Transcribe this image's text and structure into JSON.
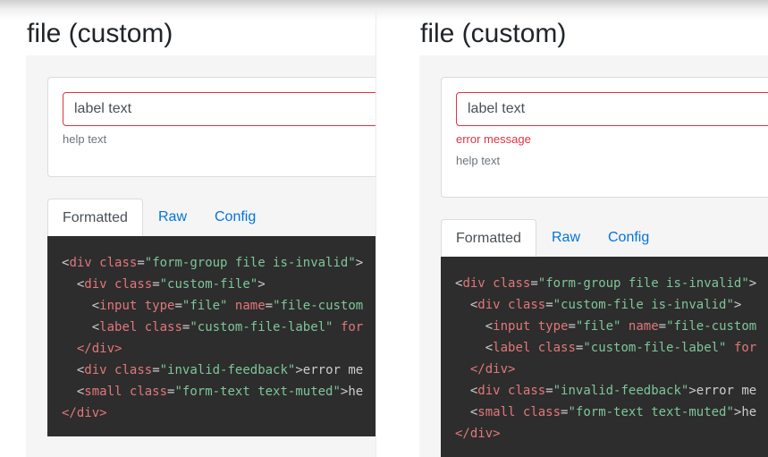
{
  "left": {
    "title": "file (custom)",
    "field": {
      "label": "label text",
      "help": "help text"
    },
    "tabs": [
      "Formatted",
      "Raw",
      "Config"
    ],
    "code": {
      "l1": {
        "tag": "div",
        "attr": "class",
        "val": "\"form-group file is-invalid\"",
        "end": ">"
      },
      "l2": {
        "tag": "div",
        "attr": "class",
        "val": "\"custom-file\"",
        "end": ">"
      },
      "l3": {
        "tag": "input",
        "attr1": "type",
        "val1": "\"file\"",
        "attr2": "name",
        "val2": "\"file-custom"
      },
      "l4": {
        "tag": "label",
        "attr1": "class",
        "val1": "\"custom-file-label\"",
        "attr2": "for"
      },
      "l5": {
        "close": "</div>"
      },
      "l6": {
        "tag": "div",
        "attr": "class",
        "val": "\"invalid-feedback\"",
        "end": ">",
        "text": "error me"
      },
      "l7": {
        "tag": "small",
        "attr": "class",
        "val": "\"form-text text-muted\"",
        "end": ">",
        "text": "he"
      },
      "l8": {
        "close": "</div>"
      }
    }
  },
  "right": {
    "title": "file (custom)",
    "field": {
      "label": "label text",
      "error": "error message",
      "help": "help text"
    },
    "tabs": [
      "Formatted",
      "Raw",
      "Config"
    ],
    "code": {
      "l1": {
        "tag": "div",
        "attr": "class",
        "val": "\"form-group file is-invalid\"",
        "end": ">"
      },
      "l2": {
        "tag": "div",
        "attr": "class",
        "val": "\"custom-file is-invalid\"",
        "end": ">"
      },
      "l3": {
        "tag": "input",
        "attr1": "type",
        "val1": "\"file\"",
        "attr2": "name",
        "val2": "\"file-custom"
      },
      "l4": {
        "tag": "label",
        "attr1": "class",
        "val1": "\"custom-file-label\"",
        "attr2": "for"
      },
      "l5": {
        "close": "</div>"
      },
      "l6": {
        "tag": "div",
        "attr": "class",
        "val": "\"invalid-feedback\"",
        "end": ">",
        "text": "error me"
      },
      "l7": {
        "tag": "small",
        "attr": "class",
        "val": "\"form-text text-muted\"",
        "end": ">",
        "text": "he"
      },
      "l8": {
        "close": "</div>"
      }
    }
  },
  "colors": {
    "invalid": "#dc3545",
    "link": "#0275d8",
    "code_bg": "#2d2d2d",
    "code_tag": "#e2777a",
    "code_string": "#7ec699"
  }
}
